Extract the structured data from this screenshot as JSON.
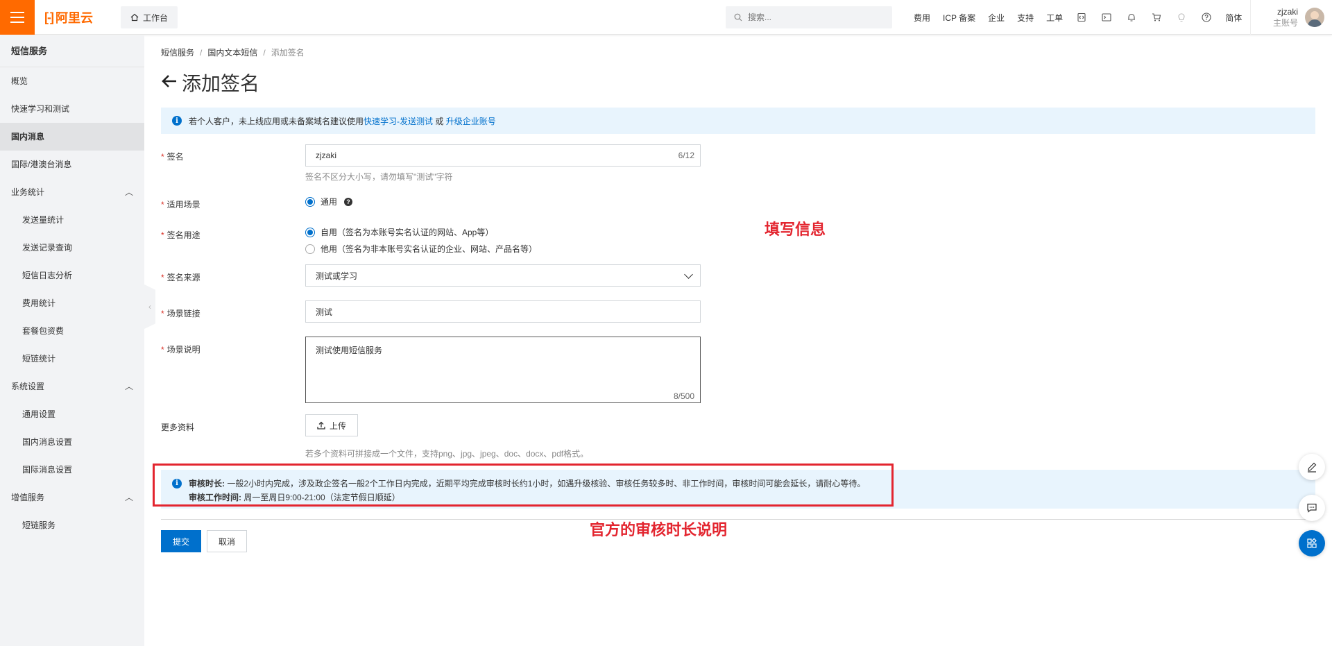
{
  "topbar": {
    "logo_text": "阿里云",
    "workbench_label": "工作台",
    "search_placeholder": "搜索...",
    "nav_items": [
      "费用",
      "ICP 备案",
      "企业",
      "支持",
      "工单"
    ],
    "language": "简体",
    "user_name": "zjzaki",
    "user_role": "主账号"
  },
  "sidebar": {
    "title": "短信服务",
    "items": [
      {
        "label": "概览"
      },
      {
        "label": "快速学习和测试"
      },
      {
        "label": "国内消息"
      },
      {
        "label": "国际/港澳台消息"
      },
      {
        "label": "业务统计"
      },
      {
        "label": "发送量统计"
      },
      {
        "label": "发送记录查询"
      },
      {
        "label": "短信日志分析"
      },
      {
        "label": "费用统计"
      },
      {
        "label": "套餐包资费"
      },
      {
        "label": "短链统计"
      },
      {
        "label": "系统设置"
      },
      {
        "label": "通用设置"
      },
      {
        "label": "国内消息设置"
      },
      {
        "label": "国际消息设置"
      },
      {
        "label": "增值服务"
      },
      {
        "label": "短链服务"
      }
    ]
  },
  "breadcrumb": [
    "短信服务",
    "国内文本短信",
    "添加签名"
  ],
  "page_title": "添加签名",
  "info_banner": {
    "text": "若个人客户，未上线应用或未备案域名建议使用",
    "link1": "快速学习-发送测试",
    "or": "或",
    "link2": "升级企业账号"
  },
  "form": {
    "signature": {
      "label": "签名",
      "value": "zjzaki",
      "count": "6/12",
      "hint": "签名不区分大小写，请勿填写\"测试\"字符"
    },
    "scene": {
      "label": "适用场景",
      "option": "通用"
    },
    "usage": {
      "label": "签名用途",
      "option1": "自用（签名为本账号实名认证的网站、App等）",
      "option2": "他用（签名为非本账号实名认证的企业、网站、产品名等）"
    },
    "source": {
      "label": "签名来源",
      "value": "测试或学习"
    },
    "scene_link": {
      "label": "场景链接",
      "value": "测试"
    },
    "scene_desc": {
      "label": "场景说明",
      "value": "测试使用短信服务",
      "count": "8/500"
    },
    "more": {
      "label": "更多资料",
      "upload_label": "上传",
      "hint": "若多个资料可拼接成一个文件，支持png、jpg、jpeg、doc、docx、pdf格式。"
    }
  },
  "review": {
    "title1": "审核时长:",
    "text1": "一般2小时内完成，涉及政企签名一般2个工作日内完成，近期平均完成审核时长约1小时，如遇升级核验、审核任务较多时、非工作时间，审核时间可能会延长，请耐心等待。",
    "title2": "审核工作时间:",
    "text2": "周一至周日9:00-21:00（法定节假日顺延）"
  },
  "buttons": {
    "submit": "提交",
    "cancel": "取消"
  },
  "annotations": {
    "fill_info": "填写信息",
    "review_note": "官方的审核时长说明"
  },
  "colors": {
    "brand": "#ff6a00",
    "primary": "#0070cc",
    "annotation": "#e3252f"
  }
}
